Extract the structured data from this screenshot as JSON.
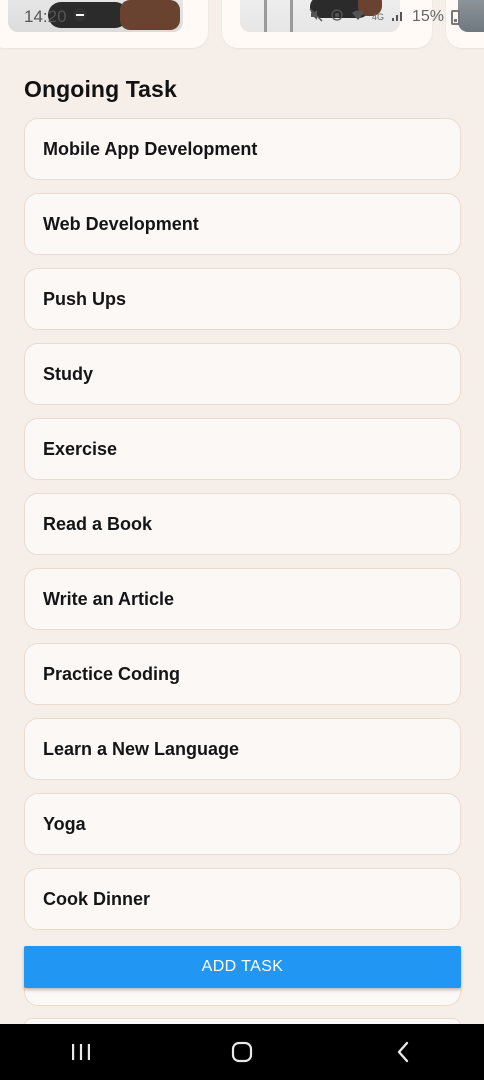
{
  "status_bar": {
    "time": "14:20",
    "network": "4G",
    "battery": "15%"
  },
  "carousel": {
    "cards": [
      {
        "icon": "photo-person-on-couch"
      },
      {
        "icon": "photo-person-at-desk"
      },
      {
        "icon": "photo-partial"
      }
    ]
  },
  "section": {
    "title": "Ongoing Task"
  },
  "tasks": [
    {
      "label": "Mobile App Development"
    },
    {
      "label": "Web Development"
    },
    {
      "label": "Push Ups"
    },
    {
      "label": "Study"
    },
    {
      "label": "Exercise"
    },
    {
      "label": "Read a Book"
    },
    {
      "label": "Write an Article"
    },
    {
      "label": "Practice Coding"
    },
    {
      "label": "Learn a New Language"
    },
    {
      "label": "Yoga"
    },
    {
      "label": "Cook Dinner"
    }
  ],
  "add_button": {
    "label": "ADD TASK",
    "color": "#2196f3"
  },
  "nav": {
    "recents_icon": "recents-icon",
    "home_icon": "home-icon",
    "back_icon": "back-icon"
  },
  "colors": {
    "background": "#f6eee8",
    "card_border": "#eadccd",
    "nav_bar": "#000000"
  }
}
